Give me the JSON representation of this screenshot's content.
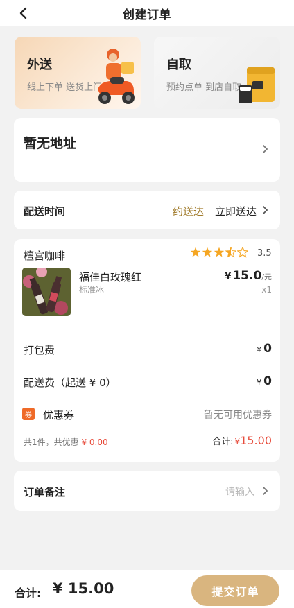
{
  "header": {
    "title": "创建订单"
  },
  "modes": [
    {
      "name": "外送",
      "desc": "线上下单  送货上门"
    },
    {
      "name": "自取",
      "desc": "预约点单  到店自取"
    }
  ],
  "address": {
    "text": "暂无地址"
  },
  "delivery_time": {
    "label": "配送时间",
    "option_scheduled": "约送达",
    "option_now": "立即送达"
  },
  "order": {
    "store": "檀宫咖啡",
    "rating": "3.5",
    "rating_value": 3.5,
    "item": {
      "name": "福佳白玫瑰红",
      "spec": "标准冰",
      "currency": "¥",
      "price": "15.0",
      "unit": "/元",
      "qty": "x1"
    },
    "packing": {
      "label": "打包费",
      "currency": "¥",
      "value": "0"
    },
    "shipping": {
      "label": "配送费（起送 ¥ 0）",
      "currency": "¥",
      "value": "0"
    },
    "coupon": {
      "tag": "券",
      "label": "优惠券",
      "value": "暂无可用优惠券"
    },
    "summary": {
      "text": "共1件，共优惠",
      "discount": "¥ 0.00",
      "subtotal_label": "合计:",
      "subtotal_currency": "¥",
      "subtotal_value": "15.00"
    }
  },
  "note": {
    "label": "订单备注",
    "placeholder": "请输入"
  },
  "footer": {
    "total_label": "合计:",
    "total_value": "¥ 15.00",
    "submit": "提交订单"
  },
  "colors": {
    "accent": "#d9b57f",
    "gold_text": "#a17c2d",
    "price_red": "#e74c3c",
    "coupon_orange": "#ef6a28",
    "star": "#f5a623"
  }
}
